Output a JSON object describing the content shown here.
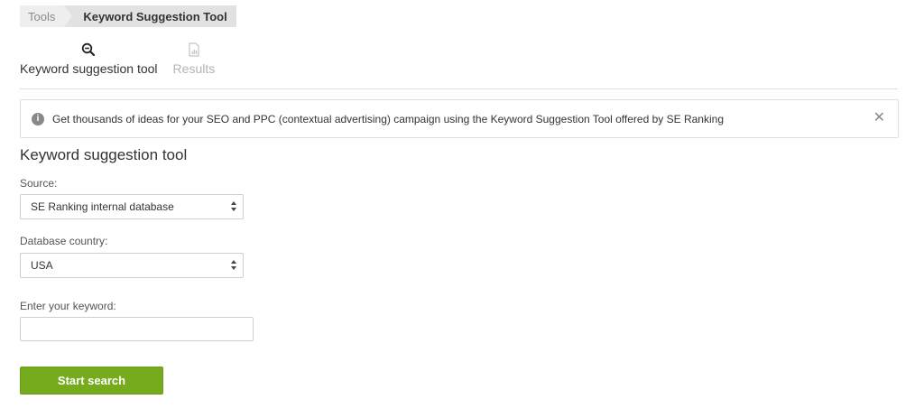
{
  "breadcrumb": {
    "items": [
      {
        "label": "Tools"
      },
      {
        "label": "Keyword Suggestion Tool"
      }
    ]
  },
  "tabs": [
    {
      "label": "Keyword suggestion tool",
      "icon": "search-zoom-icon",
      "state": "active"
    },
    {
      "label": "Results",
      "icon": "document-chart-icon",
      "state": "inactive"
    }
  ],
  "info": {
    "icon": "info-icon",
    "text": "Get thousands of ideas for your SEO and PPC (contextual advertising) campaign using the Keyword Suggestion Tool offered by SE Ranking",
    "close_icon": "close-icon"
  },
  "form": {
    "title": "Keyword suggestion tool",
    "source": {
      "label": "Source:",
      "value": "SE Ranking internal database"
    },
    "country": {
      "label": "Database country:",
      "value": "USA"
    },
    "keyword": {
      "label": "Enter your keyword:",
      "value": ""
    },
    "submit_label": "Start search"
  },
  "colors": {
    "accent_green": "#77ab1e",
    "breadcrumb_bg": "#eeeeee",
    "breadcrumb_active_bg": "#e2e2e2"
  }
}
